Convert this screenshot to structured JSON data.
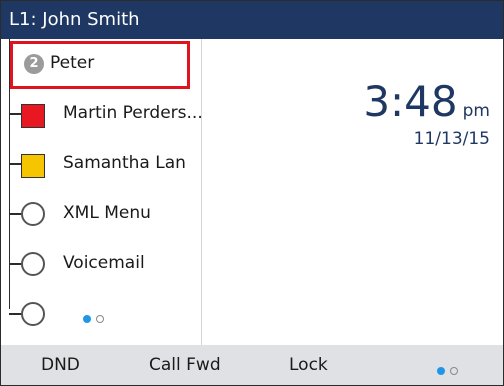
{
  "header": {
    "title": "L1: John Smith"
  },
  "sidebar": {
    "items": [
      {
        "label": "Peter",
        "badge": "2",
        "type": "line",
        "selected": true
      },
      {
        "label": "Martin Perders...",
        "type": "presence",
        "color": "#e81822"
      },
      {
        "label": "Samantha Lan",
        "type": "presence",
        "color": "#f7c400"
      },
      {
        "label": "XML Menu",
        "type": "empty"
      },
      {
        "label": "Voicemail",
        "type": "empty"
      },
      {
        "type": "empty"
      }
    ],
    "page_indicator": {
      "current": 1,
      "total": 2
    }
  },
  "clock": {
    "time": "3:48",
    "ampm": "pm",
    "date": "11/13/15"
  },
  "softkeys": {
    "items": [
      {
        "label": "DND"
      },
      {
        "label": "Call Fwd"
      },
      {
        "label": "Lock"
      }
    ],
    "page_indicator": {
      "current": 1,
      "total": 2
    }
  },
  "colors": {
    "header_bg": "#1f3763",
    "softkey_bg": "#dfe1e4",
    "selection_border": "#e0141e",
    "page_dot_active": "#2196e8"
  }
}
